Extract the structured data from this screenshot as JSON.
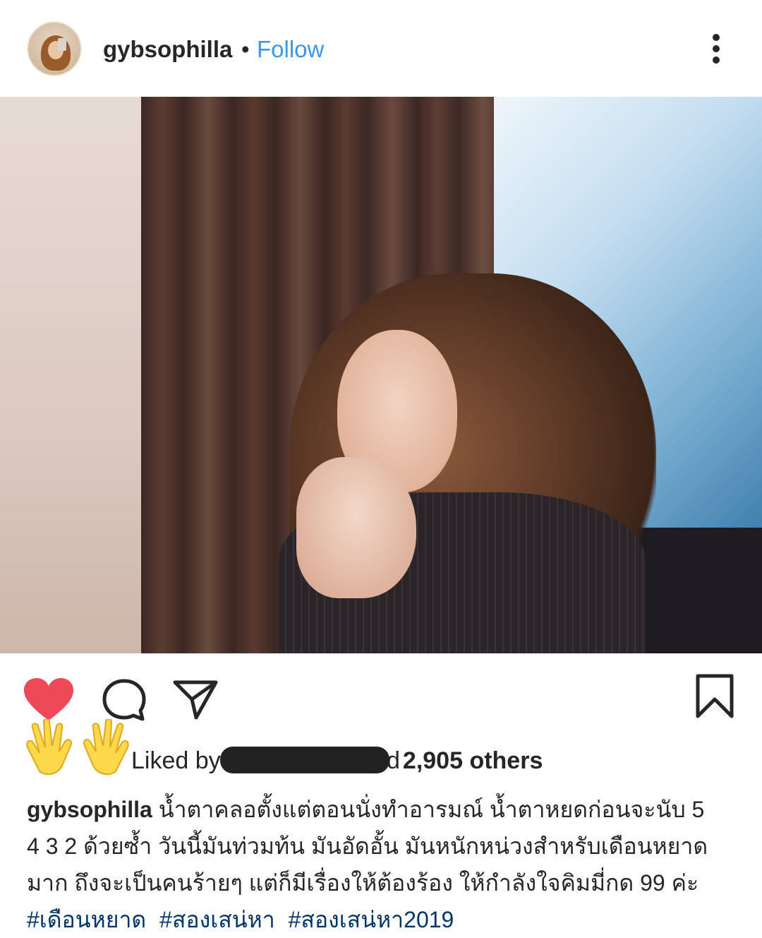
{
  "header": {
    "username": "gybsophilla",
    "separator": "•",
    "follow_label": "Follow"
  },
  "post": {
    "image_alt": "photo"
  },
  "actions": {
    "like_icon": "heart-icon",
    "comment_icon": "comment-icon",
    "share_icon": "share-icon",
    "save_icon": "bookmark-icon",
    "like_color": "#ed4956"
  },
  "likes": {
    "prefix": "Liked by",
    "suffix_char": "d",
    "count_text": "2,905 others"
  },
  "caption": {
    "username": "gybsophilla",
    "line1": "น้ำตาคลอตั้งแต่ตอนนั่งทำอารมณ์ น้ำตาหยดก่อนจะนับ 5",
    "line2": "4 3 2 ด้วยซ้ำ วันนี้มันท่วมท้น มันอัดอั้น มันหนักหน่วงสำหรับเดือนหยาด",
    "line3": "มาก ถึงจะเป็นคนร้ายๆ แต่ก็มีเรื่องให้ต้องร้อง ให้กำลังใจคิมมี่กด 99 ค่ะ",
    "hashtags": [
      "#เดือนหยาด",
      "#สองเสน่หา",
      "#สองเสน่หา2019"
    ]
  },
  "colors": {
    "link": "#3897f0",
    "hashtag": "#003569"
  }
}
